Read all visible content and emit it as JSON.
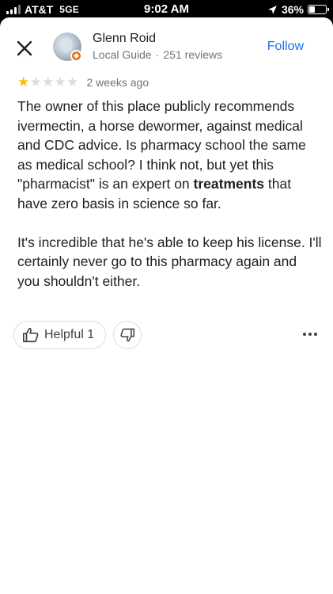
{
  "status_bar": {
    "carrier": "AT&T",
    "network": "5GE",
    "time": "9:02 AM",
    "battery": "36%",
    "battery_level": 0.36
  },
  "reviewer": {
    "name": "Glenn Roid",
    "role": "Local Guide",
    "reviews": "251 reviews"
  },
  "follow_label": "Follow",
  "rating": {
    "value": 1,
    "max": 5,
    "date": "2 weeks ago"
  },
  "review": {
    "p1_before": "The owner of this place publicly recommends ivermectin, a horse dewormer, against medical and CDC advice. Is pharmacy school the same as medical school? I think not, but yet this \"pharmacist\" is an expert on ",
    "p1_bold": "treatments",
    "p1_after": " that have zero basis in science so far.",
    "p2": "It's incredible that he's able to keep his license. I'll certainly never go to this pharmacy again and you shouldn't either."
  },
  "actions": {
    "helpful_label": "Helpful 1"
  },
  "colors": {
    "accent": "#1a73e8",
    "star_on": "#fbbc04",
    "star_off": "#dadce0",
    "badge": "#e8711c"
  },
  "icons": [
    "close-icon",
    "thumbs-up-icon",
    "thumbs-down-icon",
    "more-horizontal-icon",
    "location-arrow-icon",
    "battery-icon",
    "signal-icon"
  ]
}
